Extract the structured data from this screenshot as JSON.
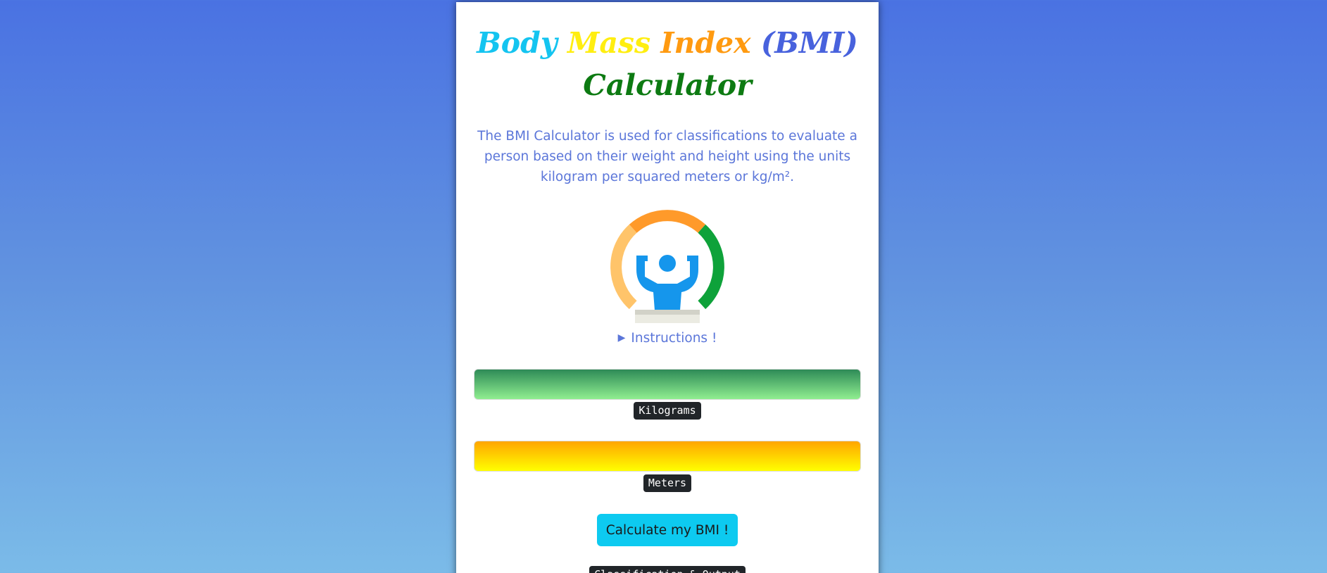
{
  "title": {
    "word1": "Body",
    "word2": "Mass",
    "word3": "Index",
    "word4": "(BMI)",
    "word5": "Calculator"
  },
  "description": "The BMI Calculator is used for classifications to evaluate a person based on their weight and height using the units kilogram per squared meters or kg/m².",
  "logo_icon": "bmi-gauge-strongman-icon",
  "instructions": {
    "arrow": "▶",
    "label": "Instructions !"
  },
  "weight": {
    "value": "",
    "unit_label": "Kilograms"
  },
  "height": {
    "value": "",
    "unit_label": "Meters"
  },
  "calculate_label": "Calculate my BMI !",
  "output_label": "Classification & Output",
  "colors": {
    "body": "#14c4f0",
    "mass": "#ffee10",
    "index": "#ff9a10",
    "bmi": "#4862dd",
    "calculator": "#0d7a12",
    "button": "#0dcaf0"
  }
}
